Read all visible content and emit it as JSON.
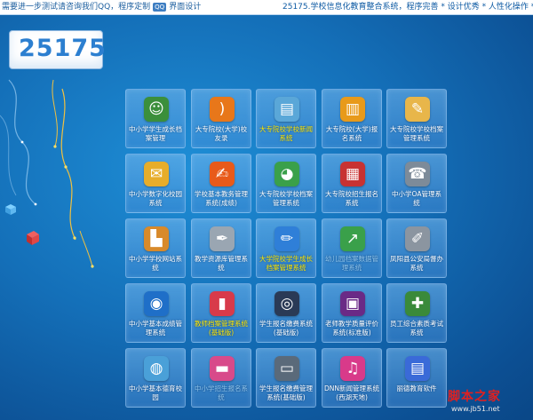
{
  "topbar": {
    "left_text": "需要进一步测试请咨询我们QQ，程序定制",
    "qq_badge": "QQ",
    "left_tail": "界面设计",
    "right_text": "25175.学校信息化教育整合系统，程序完善 * 设计优秀 * 人性化操作 * 精品质"
  },
  "logo": {
    "text": "25175"
  },
  "tiles": [
    {
      "label": "中小学学生成长档案管理",
      "icon": "users-group-icon",
      "color": "#3b8f3b",
      "glyph": "☺",
      "style": "normal"
    },
    {
      "label": "大专院校(大学)校友录",
      "icon": "rss-icon",
      "color": "#e8771a",
      "glyph": ")",
      "style": "normal"
    },
    {
      "label": "大专院校学校新闻系统",
      "icon": "newspaper-icon",
      "color": "#5aa7d8",
      "glyph": "▤",
      "style": "highlight"
    },
    {
      "label": "大专院校(大学)报名系统",
      "icon": "folder-icon",
      "color": "#e89a1a",
      "glyph": "▥",
      "style": "normal"
    },
    {
      "label": "大专院校学校档案管理系统",
      "icon": "clipboard-icon",
      "color": "#e8b64a",
      "glyph": "✎",
      "style": "normal"
    },
    {
      "label": "中小学数字化校园系统",
      "icon": "chat-bubbles-icon",
      "color": "#e7ad2a",
      "glyph": "✉",
      "style": "normal"
    },
    {
      "label": "学校基本教务管理系统(成绩)",
      "icon": "notepad-pencil-icon",
      "color": "#e85a1a",
      "glyph": "✍",
      "style": "normal"
    },
    {
      "label": "大专院校学校档案管理系统",
      "icon": "pie-chart-icon",
      "color": "#3aa04a",
      "glyph": "◕",
      "style": "normal"
    },
    {
      "label": "大专院校招生报名系统",
      "icon": "calendar-icon",
      "color": "#c83232",
      "glyph": "▦",
      "style": "normal"
    },
    {
      "label": "中小学OA管理系统",
      "icon": "fax-machine-icon",
      "color": "#7d8b99",
      "glyph": "☎",
      "style": "normal"
    },
    {
      "label": "中小学学校网站系统",
      "icon": "building-icon",
      "color": "#d88a2a",
      "glyph": "▙",
      "style": "normal"
    },
    {
      "label": "教学资源库管理系统",
      "icon": "paper-pen-icon",
      "color": "#9aa6b2",
      "glyph": "✒",
      "style": "normal"
    },
    {
      "label": "大学院校学生成长档案管理系统",
      "icon": "edit-pencil-icon",
      "color": "#2f7fd8",
      "glyph": "✏",
      "style": "highlight"
    },
    {
      "label": "幼儿园档案数据管理系统",
      "icon": "chart-up-icon",
      "color": "#3aa04a",
      "glyph": "↗",
      "style": "dim"
    },
    {
      "label": "凤阳县公安局督办系统",
      "icon": "document-pen-icon",
      "color": "#8b95a0",
      "glyph": "✐",
      "style": "normal"
    },
    {
      "label": "中小学基本成绩管理系统",
      "icon": "person-globe-icon",
      "color": "#1f6fc8",
      "glyph": "◉",
      "style": "normal"
    },
    {
      "label": "教师档案管理系统(基础版)",
      "icon": "books-icon",
      "color": "#d83a4a",
      "glyph": "▮",
      "style": "highlight"
    },
    {
      "label": "学生报名缴费系统(基础版)",
      "icon": "spiral-icon",
      "color": "#2a3a56",
      "glyph": "◎",
      "style": "normal"
    },
    {
      "label": "老师教学质量评价系统(标准版)",
      "icon": "film-strip-icon",
      "color": "#6a2a86",
      "glyph": "▣",
      "style": "normal"
    },
    {
      "label": "员工综合素质考试系统",
      "icon": "person-add-icon",
      "color": "#3a8a3a",
      "glyph": "✚",
      "style": "normal"
    },
    {
      "label": "中小学基本德育校园",
      "icon": "globe-icon",
      "color": "#4aa0d8",
      "glyph": "◍",
      "style": "normal"
    },
    {
      "label": "中小学招生报名系统",
      "icon": "book-stack-icon",
      "color": "#d84a8a",
      "glyph": "▬",
      "style": "dim"
    },
    {
      "label": "学生报名缴费管理系统(基础版)",
      "icon": "laptop-icon",
      "color": "#5a6a7a",
      "glyph": "▭",
      "style": "normal"
    },
    {
      "label": "DNN新闻管理系统(西湖天地)",
      "icon": "music-note-icon",
      "color": "#d83a8a",
      "glyph": "♫",
      "style": "normal"
    },
    {
      "label": "丽德教育软件",
      "icon": "books-stack-icon",
      "color": "#3a6ad8",
      "glyph": "▤",
      "style": "normal"
    }
  ],
  "watermark": {
    "main": "脚本之家",
    "sub": "www.jb51.net"
  }
}
